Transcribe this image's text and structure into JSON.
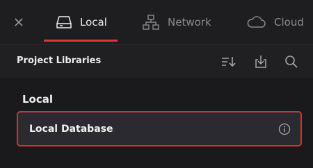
{
  "tabs": [
    {
      "label": "Local",
      "icon": "drive-icon",
      "active": true
    },
    {
      "label": "Network",
      "icon": "network-icon",
      "active": false
    },
    {
      "label": "Cloud",
      "icon": "cloud-icon",
      "active": false
    }
  ],
  "close_icon": "close-icon",
  "libraries": {
    "title": "Project Libraries",
    "tools": [
      "sort-icon",
      "import-icon",
      "search-icon"
    ]
  },
  "section": {
    "title": "Local",
    "items": [
      {
        "label": "Local Database",
        "icon": "info-icon",
        "selected": true
      }
    ]
  },
  "colors": {
    "accent": "#d43a3a",
    "background": "#1e1e21",
    "selected_item_bg": "#2b2a30"
  }
}
